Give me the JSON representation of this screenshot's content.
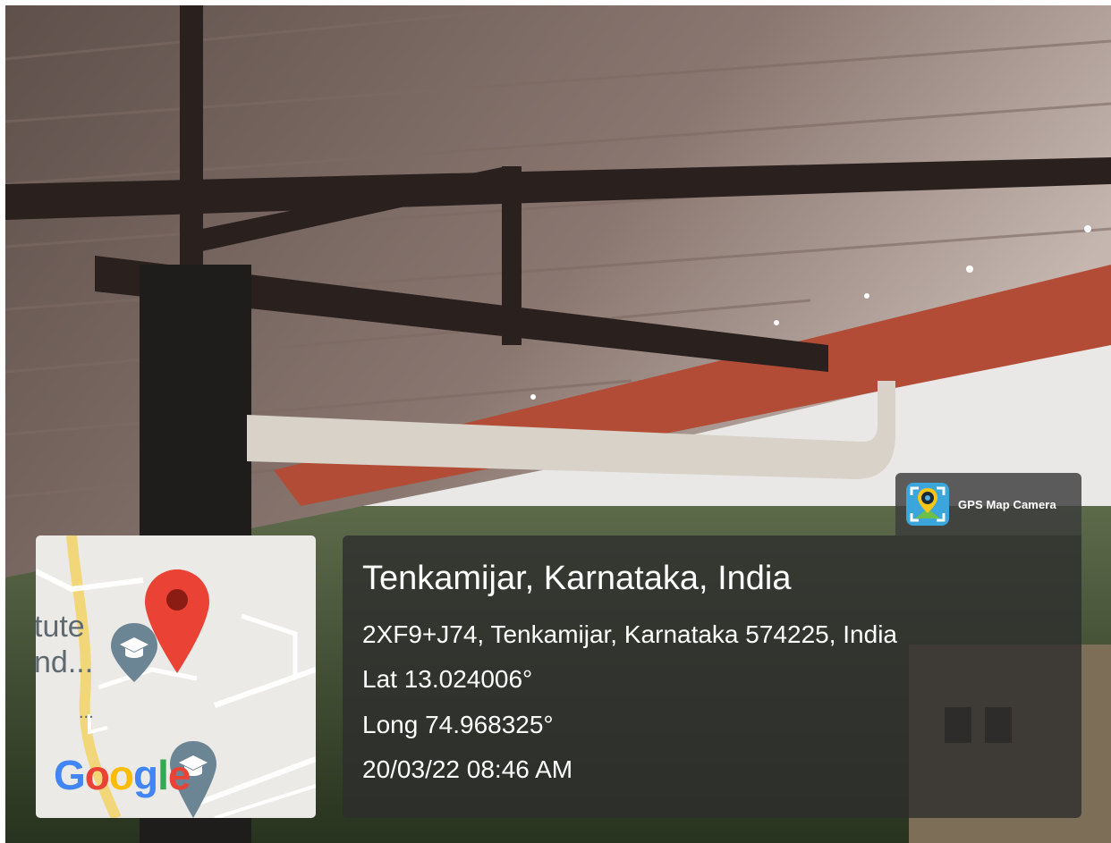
{
  "badge": {
    "app_name": "GPS Map Camera",
    "logo_icon": "gps-camera-logo-icon"
  },
  "location": {
    "place": "Tenkamijar, Karnataka, India",
    "address": "2XF9+J74, Tenkamijar, Karnataka 574225, India",
    "latitude": "Lat 13.024006°",
    "longitude": "Long 74.968325°",
    "datetime": "20/03/22 08:46 AM"
  },
  "map": {
    "label_line1": "tute",
    "label_line2": "nd...",
    "label_line3": "...",
    "google_letters": [
      "G",
      "o",
      "o",
      "g",
      "l",
      "e"
    ],
    "google_colors": [
      "#4285F4",
      "#EA4335",
      "#FBBC05",
      "#4285F4",
      "#34A853",
      "#EA4335"
    ],
    "pin_color": "#EA4335",
    "poi_color": "#6b8594",
    "road_color": "#f2d77a"
  },
  "colors": {
    "panel_bg": "#2d2d2d",
    "text": "#ffffff"
  }
}
